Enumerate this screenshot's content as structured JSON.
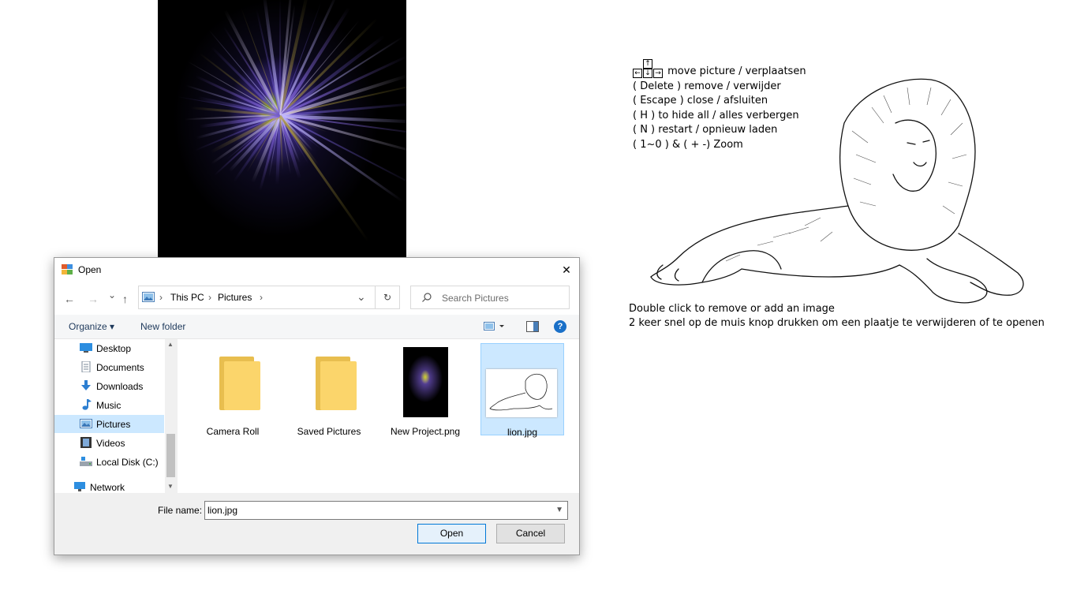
{
  "desktop": {
    "keys_help": {
      "arrow_line": "move picture / verplaatsen",
      "lines": [
        "( Delete )  remove / verwijder",
        "( Escape )  close /  afsluiten",
        "( H ) to hide all / alles verbergen",
        "( N ) restart / opnieuw laden",
        "( 1~0 ) & ( + -) Zoom"
      ]
    },
    "bottom_lines": [
      "Double click to remove or add an image",
      "2 keer snel op de muis knop drukken om een plaatje te verwijderen of te openen"
    ]
  },
  "dialog": {
    "title": "Open",
    "close_glyph": "✕",
    "nav": {
      "back": "←",
      "forward": "→",
      "recent": "⌄",
      "up": "↑"
    },
    "address": {
      "segments": [
        "This PC",
        "Pictures"
      ],
      "separator": "›"
    },
    "refresh_glyph": "↻",
    "search_placeholder": "Search Pictures",
    "toolbar": {
      "organize": "Organize ▾",
      "new_folder": "New folder",
      "help": "?"
    },
    "sidebar": [
      {
        "label": "Desktop",
        "icon": "desktop-icon"
      },
      {
        "label": "Documents",
        "icon": "documents-icon"
      },
      {
        "label": "Downloads",
        "icon": "downloads-icon"
      },
      {
        "label": "Music",
        "icon": "music-icon"
      },
      {
        "label": "Pictures",
        "icon": "pictures-icon",
        "selected": true
      },
      {
        "label": "Videos",
        "icon": "videos-icon"
      },
      {
        "label": "Local Disk (C:)",
        "icon": "disk-icon"
      },
      {
        "label": "Network",
        "icon": "network-icon"
      }
    ],
    "files": [
      {
        "name": "Camera Roll",
        "type": "folder"
      },
      {
        "name": "Saved Pictures",
        "type": "folder"
      },
      {
        "name": "New Project.png",
        "type": "image"
      },
      {
        "name": "lion.jpg",
        "type": "image",
        "selected": true
      }
    ],
    "file_name_label": "File name:",
    "file_name_value": "lion.jpg",
    "open_label": "Open",
    "cancel_label": "Cancel"
  },
  "colors": {
    "selection": "#cce8ff",
    "accent": "#0078d7",
    "folder": "#fbd56b"
  }
}
